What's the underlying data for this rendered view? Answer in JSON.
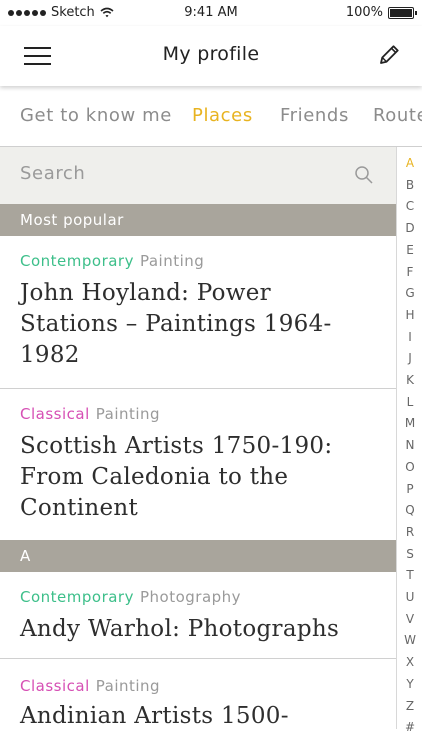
{
  "status_bar": {
    "carrier": "Sketch",
    "time": "9:41 AM",
    "battery": "100%",
    "battery_level": 1.0
  },
  "navbar": {
    "title": "My profile",
    "menu_icon": "hamburger-menu-icon",
    "edit_icon": "pencil-icon"
  },
  "tabs": [
    {
      "label": "Get to know me",
      "active": false
    },
    {
      "label": "Places",
      "active": true
    },
    {
      "label": "Friends",
      "active": false
    },
    {
      "label": "Routes",
      "active": false
    }
  ],
  "search": {
    "placeholder": "Search",
    "icon": "search-icon"
  },
  "sections": [
    {
      "header": "Most popular"
    },
    {
      "header": "A"
    }
  ],
  "items": [
    {
      "category": "Contemporary",
      "category_color": "#3dbf8a",
      "type": "Painting",
      "title": "John Hoyland: Power Stations – Paintings 1964-1982"
    },
    {
      "category": "Classical",
      "category_color": "#d64fb4",
      "type": "Painting",
      "title": "Scottish Artists 1750-190: From Caledonia to the Continent"
    },
    {
      "category": "Contemporary",
      "category_color": "#3dbf8a",
      "type": "Photography",
      "title": "Andy Warhol: Photographs"
    },
    {
      "category": "Classical",
      "category_color": "#d64fb4",
      "type": "Painting",
      "title": "Andinian Artists 1500-"
    }
  ],
  "alphabet_index": [
    "A",
    "B",
    "C",
    "D",
    "E",
    "F",
    "G",
    "H",
    "I",
    "J",
    "K",
    "L",
    "M",
    "N",
    "O",
    "P",
    "Q",
    "R",
    "S",
    "T",
    "U",
    "V",
    "W",
    "X",
    "Y",
    "Z",
    "#"
  ],
  "alphabet_active": "A",
  "colors": {
    "accent": "#e8b320",
    "contemporary": "#3dbf8a",
    "classical": "#d64fb4",
    "section_bg": "#a9a59c",
    "search_bg": "#efefec"
  }
}
